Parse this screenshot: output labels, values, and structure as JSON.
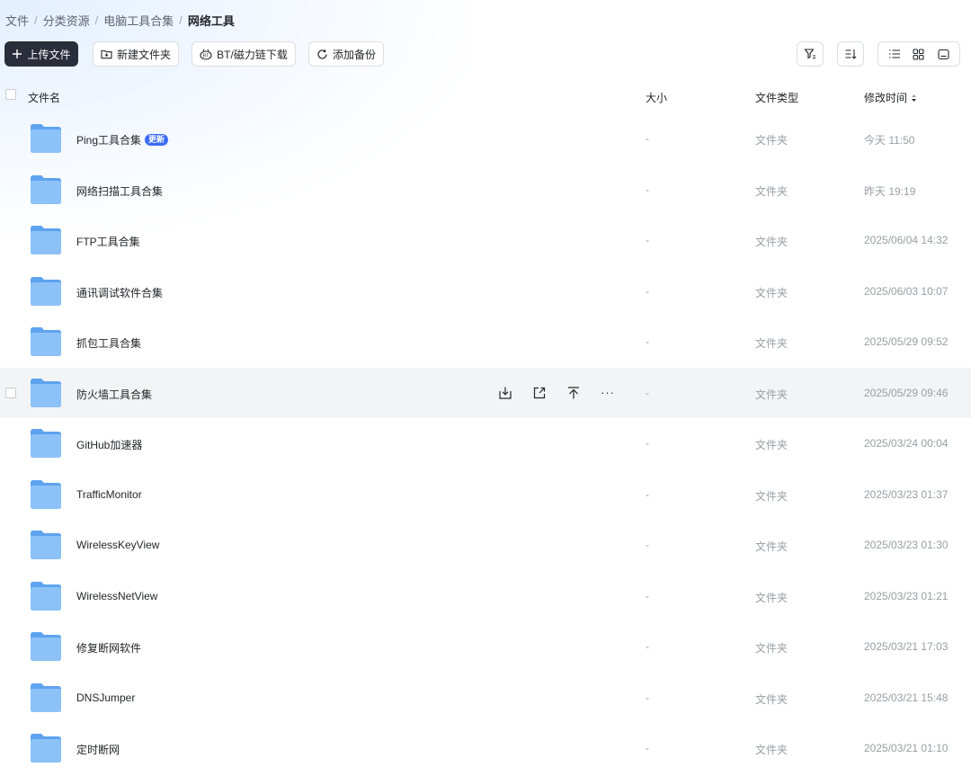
{
  "breadcrumb": {
    "items": [
      "文件",
      "分类资源",
      "电脑工具合集"
    ],
    "separator": "/",
    "current": "网络工具"
  },
  "toolbar": {
    "upload_label": "上传文件",
    "new_folder_label": "新建文件夹",
    "bt_download_label": "BT/磁力链下载",
    "add_backup_label": "添加备份"
  },
  "header": {
    "name": "文件名",
    "size": "大小",
    "type": "文件类型",
    "modified": "修改时间"
  },
  "rows": [
    {
      "name": "Ping工具合集",
      "badge": "更新",
      "size": "-",
      "type": "文件夹",
      "modified": "今天 11:50"
    },
    {
      "name": "网络扫描工具合集",
      "size": "-",
      "type": "文件夹",
      "modified": "昨天 19:19"
    },
    {
      "name": "FTP工具合集",
      "size": "-",
      "type": "文件夹",
      "modified": "2025/06/04 14:32"
    },
    {
      "name": "通讯调试软件合集",
      "size": "-",
      "type": "文件夹",
      "modified": "2025/06/03 10:07"
    },
    {
      "name": "抓包工具合集",
      "size": "-",
      "type": "文件夹",
      "modified": "2025/05/29 09:52"
    },
    {
      "name": "防火墙工具合集",
      "size": "-",
      "type": "文件夹",
      "modified": "2025/05/29 09:46",
      "hovered": true
    },
    {
      "name": "GitHub加速器",
      "size": "-",
      "type": "文件夹",
      "modified": "2025/03/24 00:04"
    },
    {
      "name": "TrafficMonitor",
      "size": "-",
      "type": "文件夹",
      "modified": "2025/03/23 01:37"
    },
    {
      "name": "WirelessKeyView",
      "size": "-",
      "type": "文件夹",
      "modified": "2025/03/23 01:30"
    },
    {
      "name": "WirelessNetView",
      "size": "-",
      "type": "文件夹",
      "modified": "2025/03/23 01:21"
    },
    {
      "name": "修复断网软件",
      "size": "-",
      "type": "文件夹",
      "modified": "2025/03/21 17:03"
    },
    {
      "name": "DNSJumper",
      "size": "-",
      "type": "文件夹",
      "modified": "2025/03/21 15:48"
    },
    {
      "name": "定时断网",
      "size": "-",
      "type": "文件夹",
      "modified": "2025/03/21 01:10"
    }
  ],
  "row_actions": {
    "more_label": "···"
  },
  "icons": {
    "folder": "folder-icon",
    "download": "download-icon",
    "share": "share-icon",
    "pin_top": "pin-top-icon",
    "filter": "filter-icon",
    "sort": "sort-icon",
    "list_view": "list-view-icon",
    "grid_view": "grid-view-icon",
    "preview_view": "preview-view-icon"
  },
  "colors": {
    "primary_button": "#2a2d3a",
    "badge": "#3b6cf6",
    "folder": "#6aaef5",
    "hover_row": "#f3f4f6"
  }
}
